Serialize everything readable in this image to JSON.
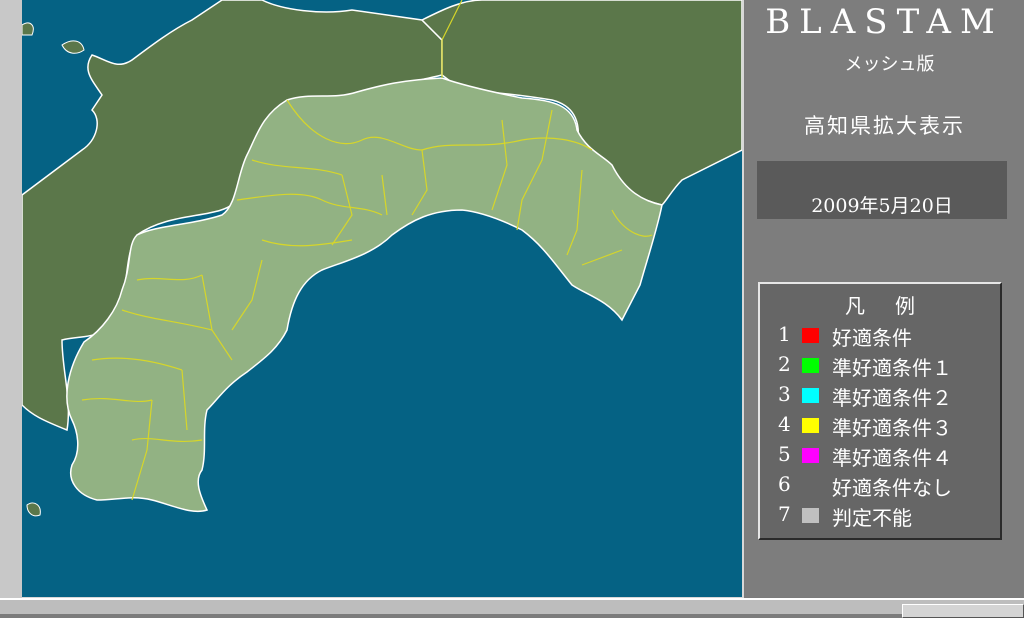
{
  "app": {
    "title": "BLASTAM",
    "subtitle": "メッシュ版"
  },
  "view": {
    "title": "高知県拡大表示",
    "date": "2009年5月20日"
  },
  "colors": {
    "sea": "#056284",
    "land_other": "#5b774a",
    "land_kochi": "#92b283",
    "border": "#d6d62a"
  },
  "legend": {
    "title": "凡例",
    "items": [
      {
        "num": "1",
        "color": "#ff0000",
        "label": "好適条件"
      },
      {
        "num": "2",
        "color": "#00ff00",
        "label": "準好適条件１"
      },
      {
        "num": "3",
        "color": "#00ffff",
        "label": "準好適条件２"
      },
      {
        "num": "4",
        "color": "#ffff00",
        "label": "準好適条件３"
      },
      {
        "num": "5",
        "color": "#ff00ff",
        "label": "準好適条件４"
      },
      {
        "num": "6",
        "color": "",
        "label": "好適条件なし"
      },
      {
        "num": "7",
        "color": "#c0c0c0",
        "label": "判定不能"
      }
    ]
  }
}
